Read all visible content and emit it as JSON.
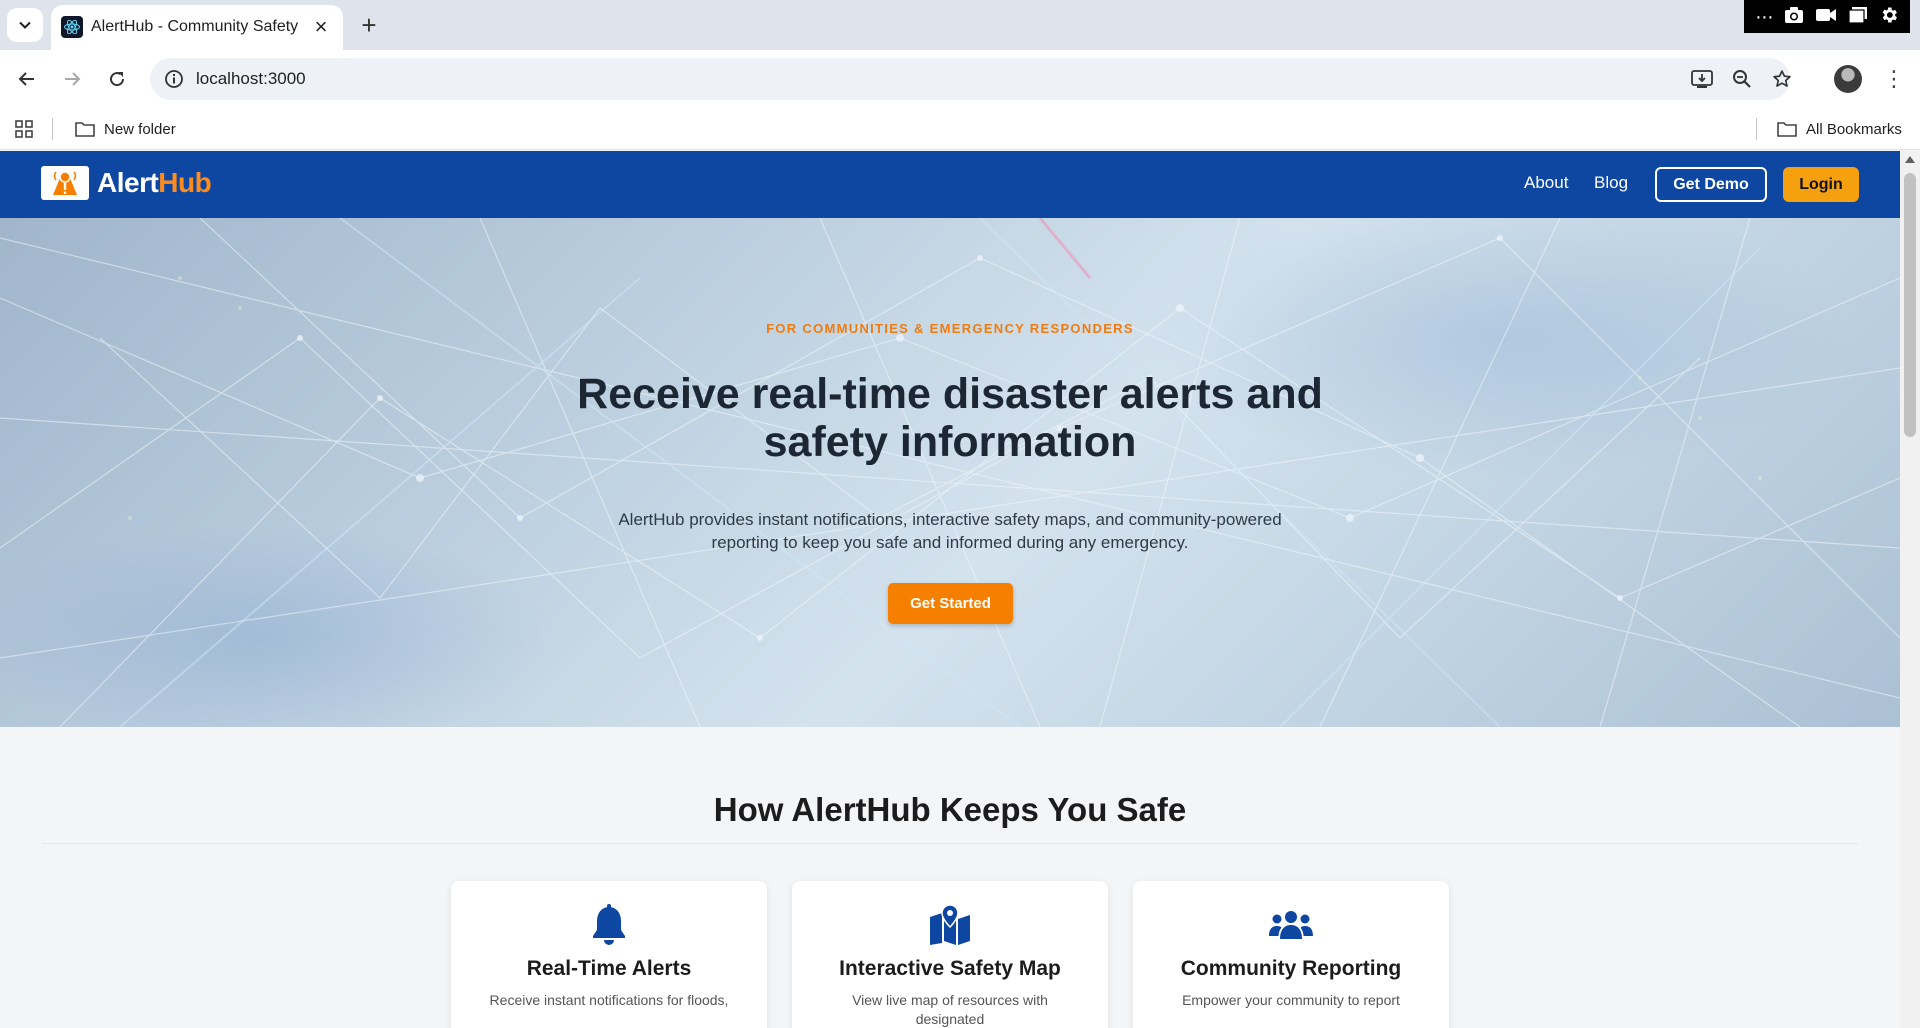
{
  "browser": {
    "tab_title": "AlertHub - Community Safety",
    "url": "localhost:3000",
    "bookmarks": {
      "folder": "New folder",
      "all": "All Bookmarks"
    }
  },
  "nav": {
    "brand_part1": "Alert",
    "brand_part2": "Hub",
    "about": "About",
    "blog": "Blog",
    "demo": "Get Demo",
    "login": "Login"
  },
  "hero": {
    "eyebrow": "FOR COMMUNITIES & EMERGENCY RESPONDERS",
    "title": "Receive real-time disaster alerts and safety information",
    "subtitle": "AlertHub provides instant notifications, interactive safety maps, and community-powered reporting to keep you safe and informed during any emergency.",
    "cta": "Get Started"
  },
  "features": {
    "heading": "How AlertHub Keeps You Safe",
    "cards": [
      {
        "icon": "bell-icon",
        "title": "Real-Time Alerts",
        "desc": "Receive instant notifications for floods,"
      },
      {
        "icon": "map-location-icon",
        "title": "Interactive Safety Map",
        "desc": "View live map of resources with designated"
      },
      {
        "icon": "users-icon",
        "title": "Community Reporting",
        "desc": "Empower your community to report"
      }
    ]
  },
  "colors": {
    "nav_blue": "#0d47a1",
    "accent_orange": "#f77f00",
    "login_yellow": "#f5a00f",
    "icon_blue": "#0d47a1"
  }
}
